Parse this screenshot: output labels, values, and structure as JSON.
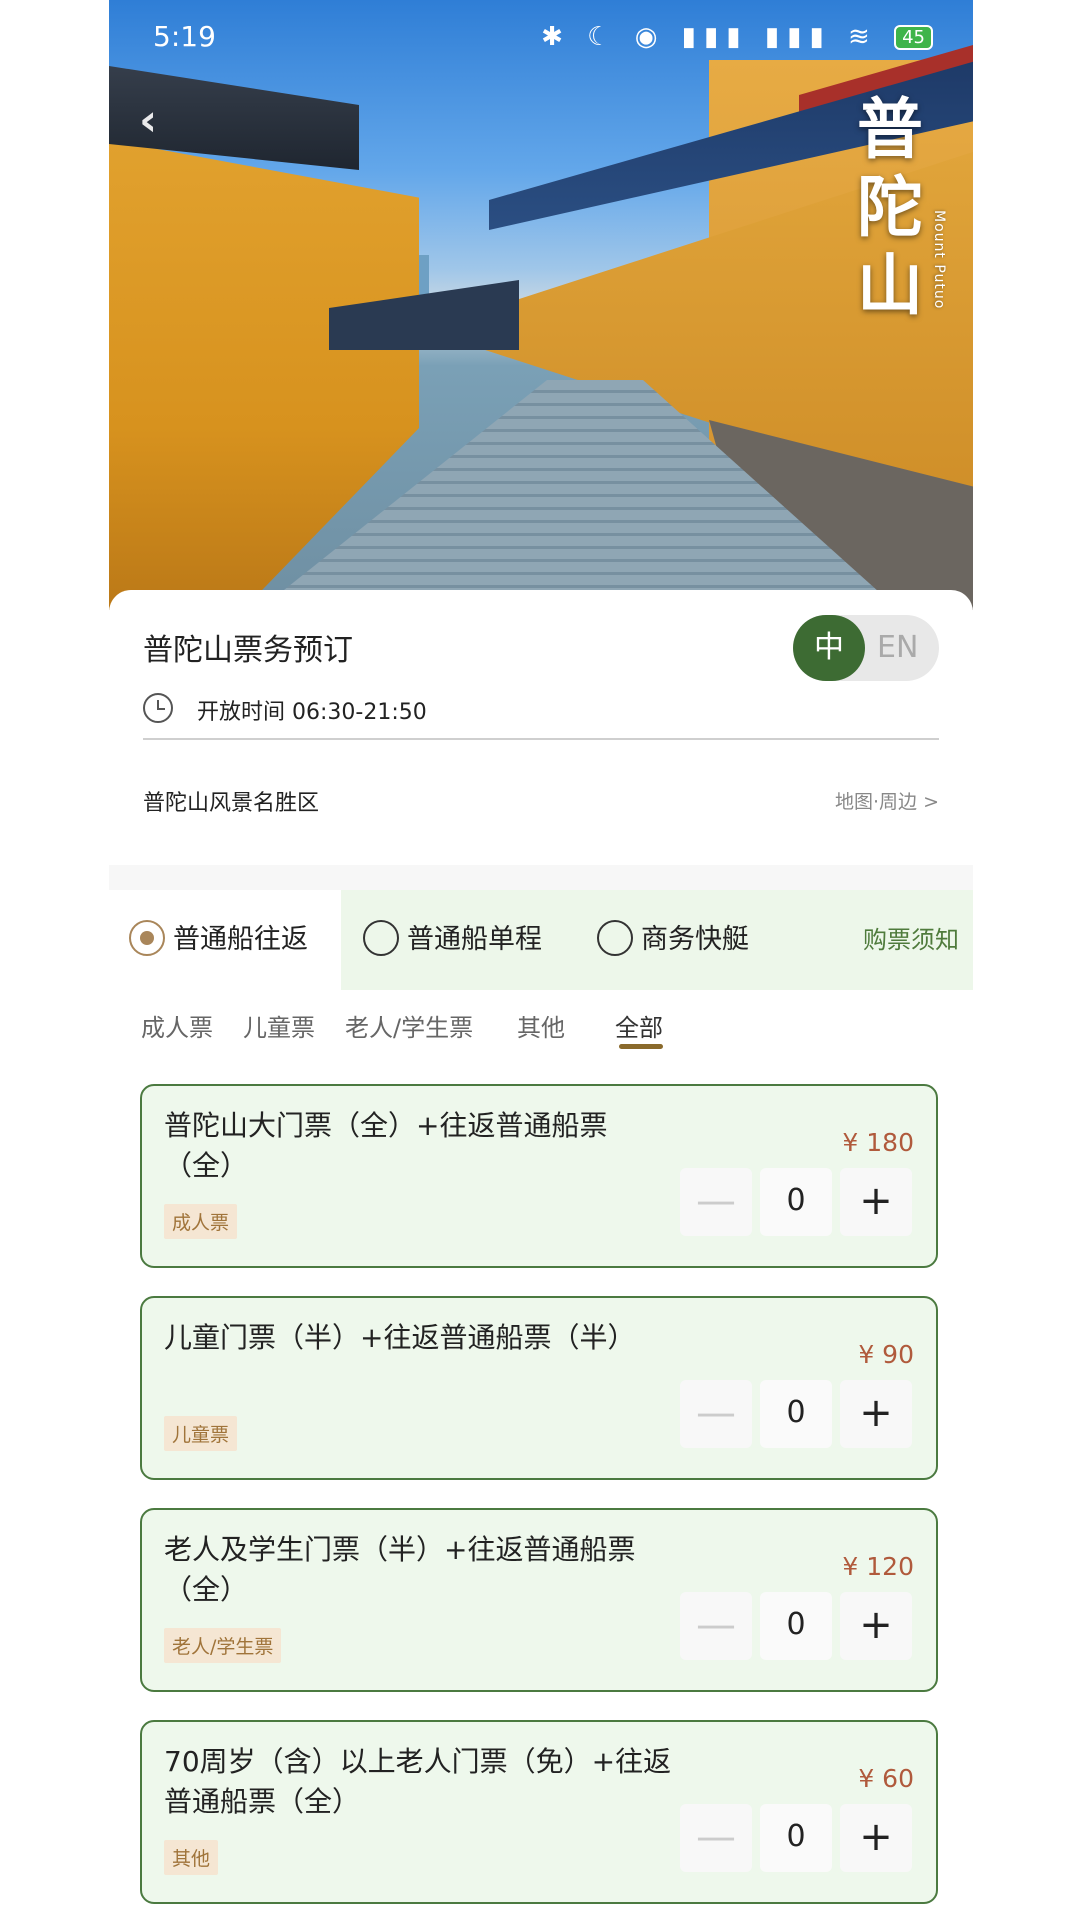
{
  "status_bar": {
    "time": "5:19",
    "icons": "✱ ☾ ◉ ▮▮▮ ▮▮▮ ≋",
    "battery": "45"
  },
  "hero": {
    "poster_title": "普陀山",
    "poster_subtitle": "Mount Putuo",
    "back_icon": "chevron-left-icon"
  },
  "header": {
    "title": "普陀山票务预订",
    "lang_zh": "中",
    "lang_en": "EN",
    "open_hours": "开放时间 06:30-21:50",
    "scenic_area": "普陀山风景名胜区",
    "map_link": "地图·周边 >"
  },
  "tabs": [
    {
      "label": "普通船往返",
      "selected": true
    },
    {
      "label": "普通船单程",
      "selected": false
    },
    {
      "label": "商务快艇",
      "selected": false
    }
  ],
  "notice_label": "购票须知",
  "categories": [
    "成人票",
    "儿童票",
    "老人/学生票",
    "其他",
    "全部"
  ],
  "active_category": "全部",
  "tickets": [
    {
      "name": "普陀山大门票（全）+往返普通船票（全）",
      "tag": "成人票",
      "price": "¥ 180",
      "minus": "—",
      "qty": "0",
      "plus": "+"
    },
    {
      "name": "儿童门票（半）+往返普通船票（半）",
      "tag": "儿童票",
      "price": "¥ 90",
      "minus": "—",
      "qty": "0",
      "plus": "+"
    },
    {
      "name": "老人及学生门票（半）+往返普通船票（全）",
      "tag": "老人/学生票",
      "price": "¥ 120",
      "minus": "—",
      "qty": "0",
      "plus": "+"
    },
    {
      "name": "70周岁（含）以上老人门票（免）+往返普通船票（全）",
      "tag": "其他",
      "price": "¥ 60",
      "minus": "—",
      "qty": "0",
      "plus": "+"
    }
  ],
  "colors": {
    "brand_green": "#3d6b33",
    "price": "#b05a3c",
    "tag_bg": "#f5e6d3",
    "card_bg": "#eef8ec"
  }
}
